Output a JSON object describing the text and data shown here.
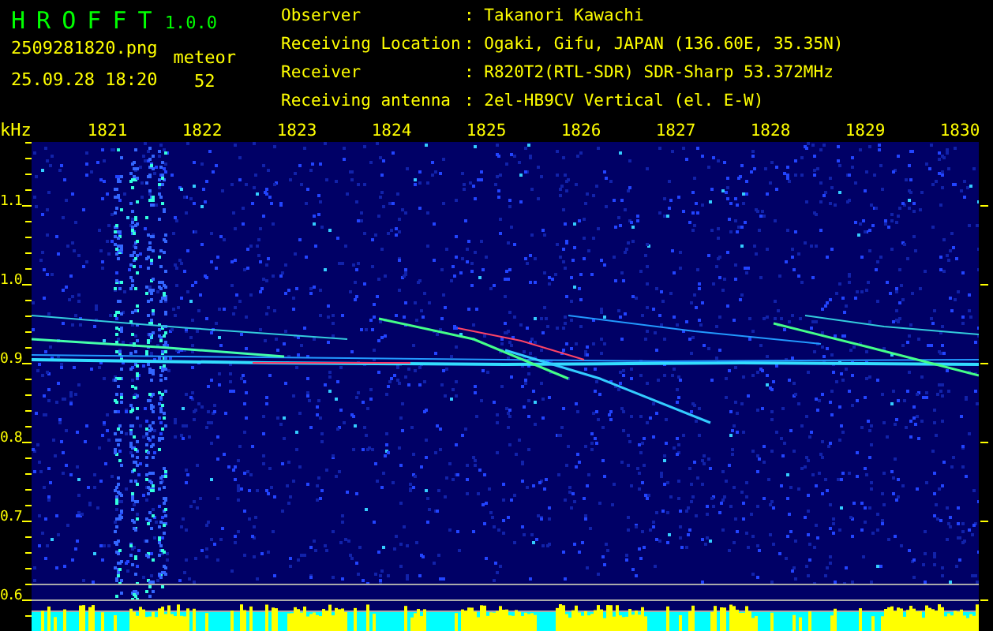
{
  "app": {
    "title": "H R O F F T",
    "version": "1.0.0"
  },
  "file": {
    "name": "2509281820.png",
    "datetime": "25.09.28 18:20"
  },
  "meteor": {
    "label": "meteor",
    "count": "52"
  },
  "info": [
    {
      "label": "Observer",
      "value": ": Takanori Kawachi"
    },
    {
      "label": "Receiving Location",
      "value": ": Ogaki, Gifu, JAPAN (136.60E, 35.35N)"
    },
    {
      "label": "Receiver",
      "value": ": R820T2(RTL-SDR) SDR-Sharp 53.372MHz"
    },
    {
      "label": "Receiving antenna",
      "value": ": 2el-HB9CV Vertical (el. E-W)"
    }
  ],
  "spectrogram": {
    "unit": "kHz",
    "x_ticks": [
      "1821",
      "1822",
      "1823",
      "1824",
      "1825",
      "1826",
      "1827",
      "1828",
      "1829",
      "1830"
    ],
    "y_ticks": [
      "1.1",
      "1.0",
      "0.9",
      "0.8",
      "0.7",
      "0.6"
    ]
  }
}
